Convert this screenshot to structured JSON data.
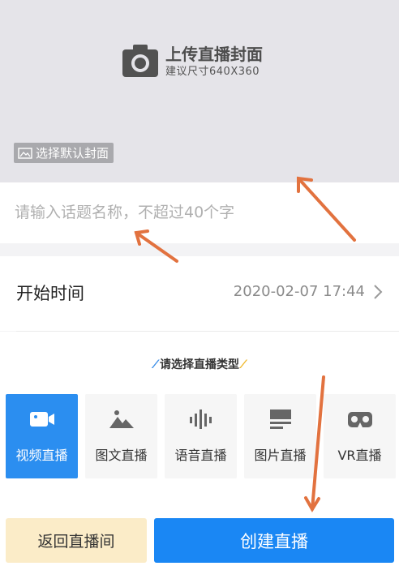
{
  "cover": {
    "upload_title": "上传直播封面",
    "upload_subtitle": "建议尺寸640X360",
    "camera_icon": "camera-icon",
    "default_cover_label": "选择默认封面",
    "default_cover_icon": "image-icon"
  },
  "topic": {
    "placeholder": "请输入话题名称，不超过40个字",
    "value": ""
  },
  "start_time": {
    "label": "开始时间",
    "value": "2020-02-07 17:44",
    "icon": "chevron-right-icon"
  },
  "types": {
    "title": "请选择直播类型",
    "selected": 0,
    "items": [
      {
        "label": "视频直播",
        "icon": "video-camera-icon"
      },
      {
        "label": "图文直播",
        "icon": "image-mountain-icon"
      },
      {
        "label": "语音直播",
        "icon": "audio-wave-icon"
      },
      {
        "label": "图片直播",
        "icon": "picture-list-icon"
      },
      {
        "label": "VR直播",
        "icon": "vr-headset-icon"
      }
    ]
  },
  "buttons": {
    "back_label": "返回直播间",
    "create_label": "创建直播"
  },
  "colors": {
    "accent": "#1a87f4",
    "active_card": "#2b8ef0",
    "back_button": "#fbecc8",
    "arrow": "#e2723f"
  }
}
